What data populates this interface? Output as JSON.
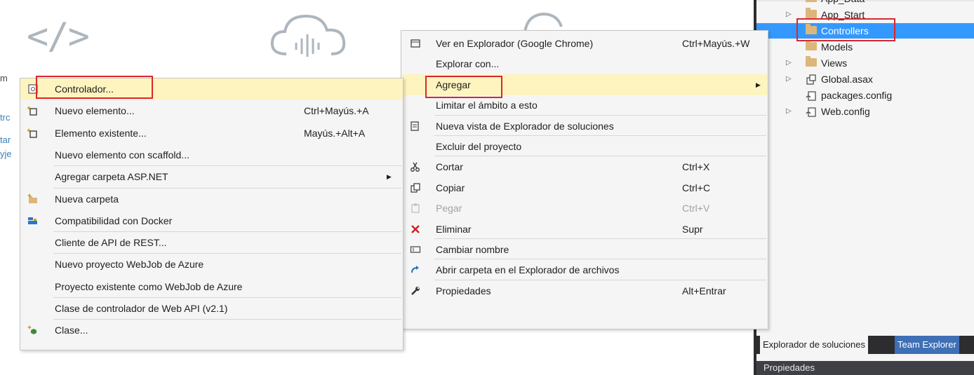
{
  "background": {
    "fragments": [
      "m",
      "trc",
      "tar",
      "yje"
    ]
  },
  "solution_explorer": {
    "tree": [
      {
        "label": "App_Data",
        "icon": "folder-icon",
        "expander": false
      },
      {
        "label": "App_Start",
        "icon": "folder-icon",
        "expander": true
      },
      {
        "label": "Controllers",
        "icon": "folder-icon",
        "expander": false,
        "selected": true
      },
      {
        "label": "Models",
        "icon": "folder-icon",
        "expander": false
      },
      {
        "label": "Views",
        "icon": "folder-icon",
        "expander": true
      },
      {
        "label": "Global.asax",
        "icon": "asax-file-icon",
        "expander": true
      },
      {
        "label": "packages.config",
        "icon": "config-file-icon",
        "expander": false
      },
      {
        "label": "Web.config",
        "icon": "config-file-icon",
        "expander": true
      }
    ],
    "tabs": [
      "Explorador de soluciones",
      "Team Explorer"
    ],
    "properties_title": "Propiedades"
  },
  "context_menu": {
    "items": [
      {
        "label": "Ver en Explorador (Google Chrome)",
        "shortcut": "Ctrl+Mayús.+W",
        "icon": "browser-view-icon"
      },
      {
        "label": "Explorar con...",
        "shortcut": "",
        "icon": ""
      },
      {
        "label": "Agregar",
        "shortcut": "",
        "icon": "",
        "submenu": true,
        "highlighted": true
      },
      {
        "label": "Limitar el ámbito a esto",
        "shortcut": "",
        "icon": ""
      },
      {
        "label": "Nueva vista de Explorador de soluciones",
        "shortcut": "",
        "icon": "new-view-icon"
      },
      {
        "label": "Excluir del proyecto",
        "shortcut": "",
        "icon": ""
      },
      {
        "label": "Cortar",
        "shortcut": "Ctrl+X",
        "icon": "scissors-icon"
      },
      {
        "label": "Copiar",
        "shortcut": "Ctrl+C",
        "icon": "copy-icon"
      },
      {
        "label": "Pegar",
        "shortcut": "Ctrl+V",
        "icon": "paste-icon",
        "disabled": true
      },
      {
        "label": "Eliminar",
        "shortcut": "Supr",
        "icon": "delete-x-icon"
      },
      {
        "label": "Cambiar nombre",
        "shortcut": "",
        "icon": "rename-icon"
      },
      {
        "label": "Abrir carpeta en el Explorador de archivos",
        "shortcut": "",
        "icon": "open-folder-arrow-icon"
      },
      {
        "label": "Propiedades",
        "shortcut": "Alt+Entrar",
        "icon": "wrench-icon"
      }
    ]
  },
  "add_submenu": {
    "items": [
      {
        "label": "Controlador...",
        "shortcut": "",
        "icon": "controller-icon",
        "highlighted": true
      },
      {
        "label": "Nuevo elemento...",
        "shortcut": "Ctrl+Mayús.+A",
        "icon": "new-item-icon"
      },
      {
        "label": "Elemento existente...",
        "shortcut": "Mayús.+Alt+A",
        "icon": "existing-item-icon"
      },
      {
        "label": "Nuevo elemento con scaffold...",
        "shortcut": "",
        "icon": ""
      },
      {
        "label": "Agregar carpeta ASP.NET",
        "shortcut": "",
        "icon": "",
        "submenu": true
      },
      {
        "label": "Nueva carpeta",
        "shortcut": "",
        "icon": "new-folder-icon"
      },
      {
        "label": "Compatibilidad con Docker",
        "shortcut": "",
        "icon": "docker-icon"
      },
      {
        "label": "Cliente de API de REST...",
        "shortcut": "",
        "icon": ""
      },
      {
        "label": "Nuevo proyecto WebJob de Azure",
        "shortcut": "",
        "icon": ""
      },
      {
        "label": "Proyecto existente como WebJob de Azure",
        "shortcut": "",
        "icon": ""
      },
      {
        "label": "Clase de controlador de Web API (v2.1)",
        "shortcut": "",
        "icon": ""
      },
      {
        "label": "Clase...",
        "shortcut": "",
        "icon": "class-icon"
      }
    ]
  },
  "colors": {
    "highlight": "#fdf4bf",
    "selection": "#3399ff",
    "annotation_box": "#d9272e",
    "menu_background": "#f5f5f5"
  }
}
